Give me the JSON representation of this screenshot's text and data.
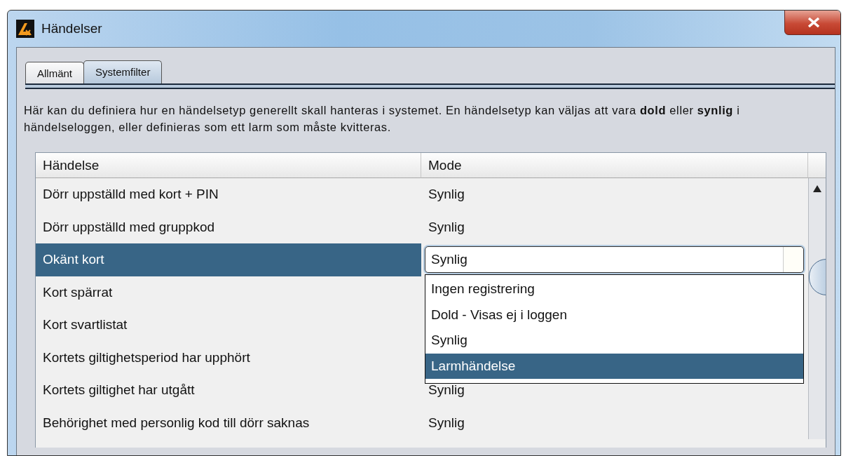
{
  "window": {
    "title": "Händelser"
  },
  "tabs": [
    {
      "label": "Allmänt",
      "selected": false
    },
    {
      "label": "Systemfilter",
      "selected": true
    }
  ],
  "description": "Här kan du definiera hur en händelsetyp generellt skall hanteras i systemet. En händelsetyp kan väljas att vara **dold** eller **synlig** i händelseloggen, eller definieras som ett larm som måste kvitteras.",
  "table": {
    "columns": [
      "Händelse",
      "Mode"
    ],
    "rows": [
      {
        "event": "Dörr uppställd med kort + PIN",
        "mode": "Synlig",
        "selected": false
      },
      {
        "event": "Dörr uppställd med gruppkod",
        "mode": "Synlig",
        "selected": false
      },
      {
        "event": "Okänt kort",
        "mode": "Synlig",
        "selected": true,
        "editing": true
      },
      {
        "event": "Kort spärrat",
        "selected": false
      },
      {
        "event": "Kort svartlistat",
        "selected": false
      },
      {
        "event": "Kortets giltighetsperiod har upphört",
        "selected": false
      },
      {
        "event": "Kortets giltighet har utgått",
        "mode": "Synlig",
        "selected": false
      },
      {
        "event": "Behörighet med personlig kod till dörr saknas",
        "mode": "Synlig",
        "selected": false
      }
    ]
  },
  "dropdown": {
    "options": [
      {
        "label": "Ingen registrering",
        "selected": false
      },
      {
        "label": "Dold - Visas ej i loggen",
        "selected": false
      },
      {
        "label": "Synlig",
        "selected": false
      },
      {
        "label": "Larmhändelse",
        "selected": true
      }
    ]
  }
}
